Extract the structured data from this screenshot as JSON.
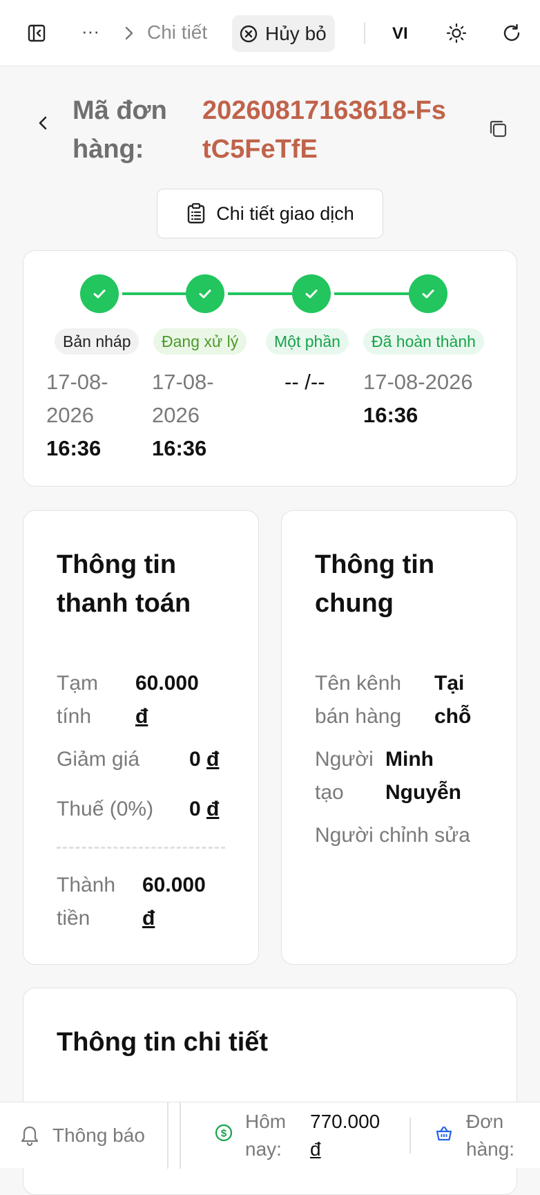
{
  "topbar": {
    "ellipsis": "···",
    "breadcrumb_current": "Chi tiết",
    "cancel_label": "Hủy bỏ",
    "language": "VI"
  },
  "order": {
    "label": "Mã đơn hàng:",
    "code": "20260817163618-FstC5FeTfE"
  },
  "transaction_button": "Chi tiết giao dịch",
  "status": {
    "steps": [
      {
        "label": "Bản nháp",
        "date": "17-08-2026",
        "time": "16:36"
      },
      {
        "label": "Đang xử lý",
        "date": "17-08-2026",
        "time": "16:36"
      },
      {
        "label": "Một phần",
        "date": "-- /--",
        "time": ""
      },
      {
        "label": "Đã hoàn thành",
        "date": "17-08-2026",
        "time": "16:36"
      }
    ],
    "colors": {
      "done": "#22c55e"
    }
  },
  "payment": {
    "title": "Thông tin thanh toán",
    "subtotal_label": "Tạm tính",
    "subtotal_value": "60.000",
    "discount_label": "Giảm giá",
    "discount_value": "0",
    "tax_label": "Thuế (0%)",
    "tax_value": "0",
    "total_label": "Thành tiền",
    "total_value": "60.000",
    "currency": "đ"
  },
  "general": {
    "title": "Thông tin chung",
    "channel_label": "Tên kênh bán hàng",
    "channel_value": "Tại chỗ",
    "creator_label": "Người tạo",
    "creator_value": "Minh Nguyễn",
    "editor_label": "Người chỉnh sửa"
  },
  "detail": {
    "title": "Thông tin chi tiết"
  },
  "bottombar": {
    "notifications_label": "Thông báo",
    "today_label": "Hôm nay:",
    "today_value": "770.000",
    "today_currency": "đ",
    "orders_label": "Đơn hàng:"
  },
  "accent_color": "#c0634a"
}
